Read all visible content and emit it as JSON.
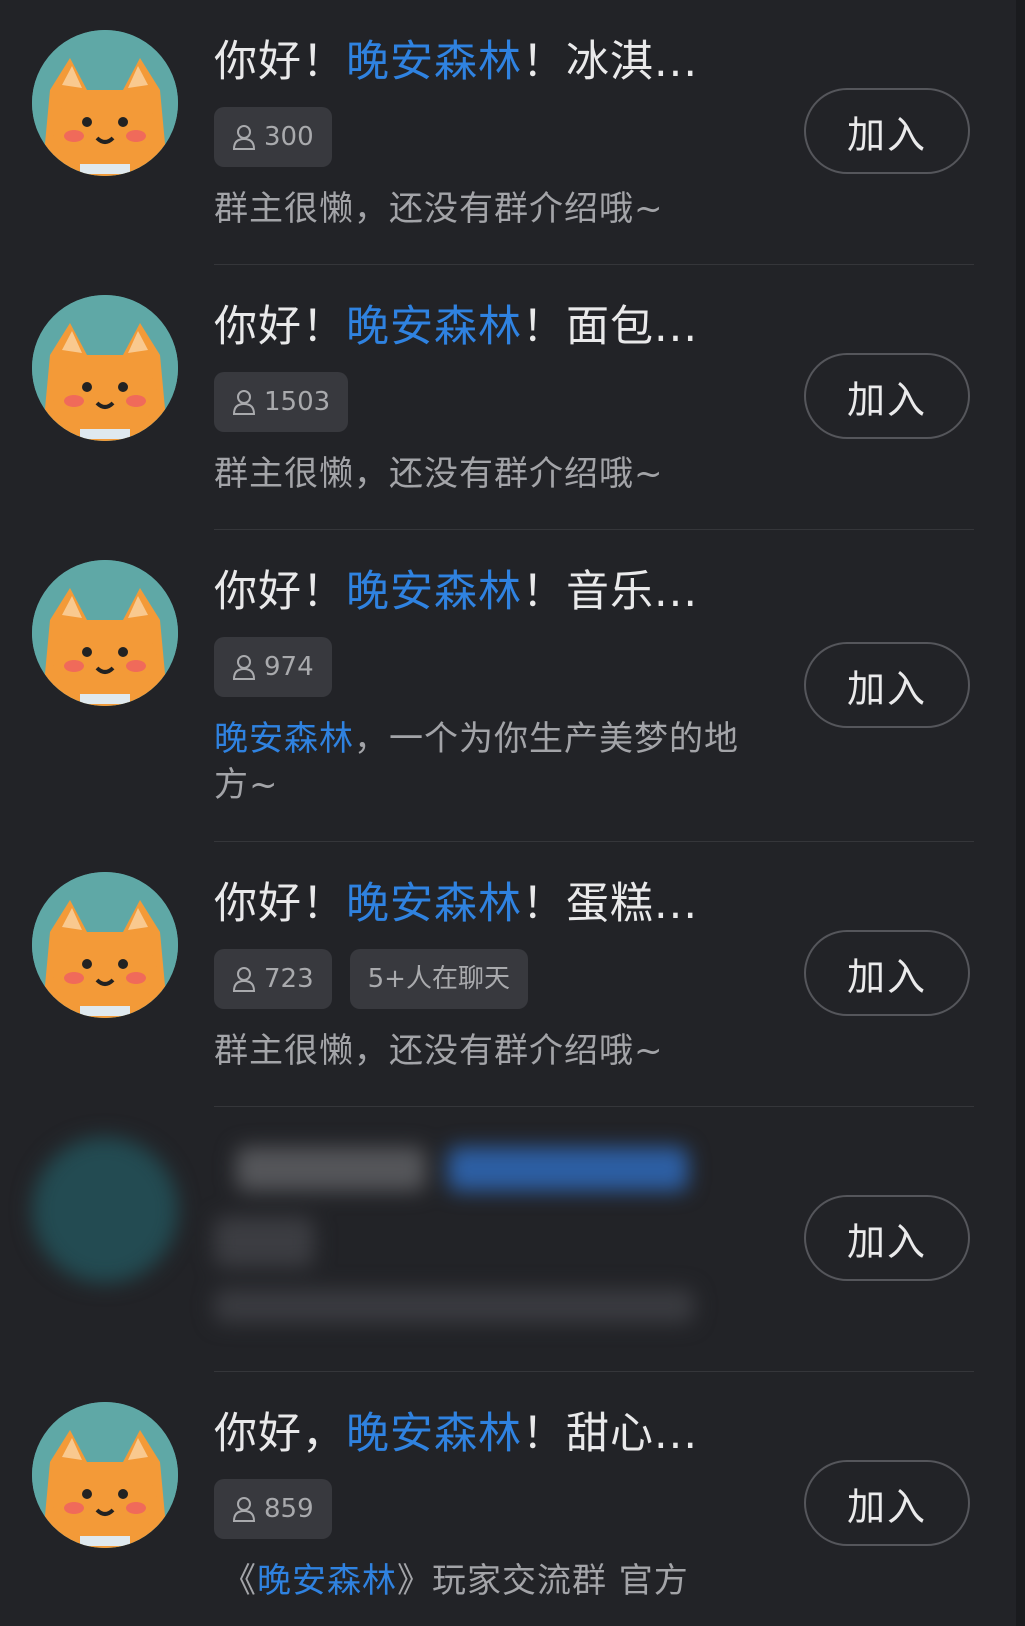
{
  "groups": [
    {
      "title_prefix": "你好！",
      "title_highlight": "晚安森林",
      "title_suffix": "！冰淇...",
      "members": "300",
      "desc_highlight": "",
      "desc": "群主很懒，还没有群介绍哦~",
      "join": "加入"
    },
    {
      "title_prefix": "你好！",
      "title_highlight": "晚安森林",
      "title_suffix": "！面包...",
      "members": "1503",
      "desc_highlight": "",
      "desc": "群主很懒，还没有群介绍哦~",
      "join": "加入"
    },
    {
      "title_prefix": "你好！",
      "title_highlight": "晚安森林",
      "title_suffix": "！音乐...",
      "members": "974",
      "desc_highlight": "晚安森林",
      "desc": "，一个为你生产美梦的地方~",
      "join": "加入"
    },
    {
      "title_prefix": "你好！",
      "title_highlight": "晚安森林",
      "title_suffix": "！蛋糕...",
      "members": "723",
      "chatting": "5+人在聊天",
      "desc_highlight": "",
      "desc": "群主很懒，还没有群介绍哦~",
      "join": "加入"
    },
    {
      "blurred": true,
      "join": "加入"
    },
    {
      "title_prefix": "你好，",
      "title_highlight": "晚安森林",
      "title_suffix": "！甜心...",
      "members": "859",
      "desc_prefix": "《",
      "desc_highlight": "晚安森林",
      "desc": "》玩家交流群 官方",
      "join": "加入"
    }
  ],
  "colors": {
    "background": "#222327",
    "highlight": "#2f82e0",
    "tag_bg": "#38393e",
    "avatar_bg": "#5fa8a6",
    "avatar_fox": "#f39a38"
  },
  "icons": {
    "member": "person-icon",
    "avatar": "fox-mascot-avatar"
  }
}
